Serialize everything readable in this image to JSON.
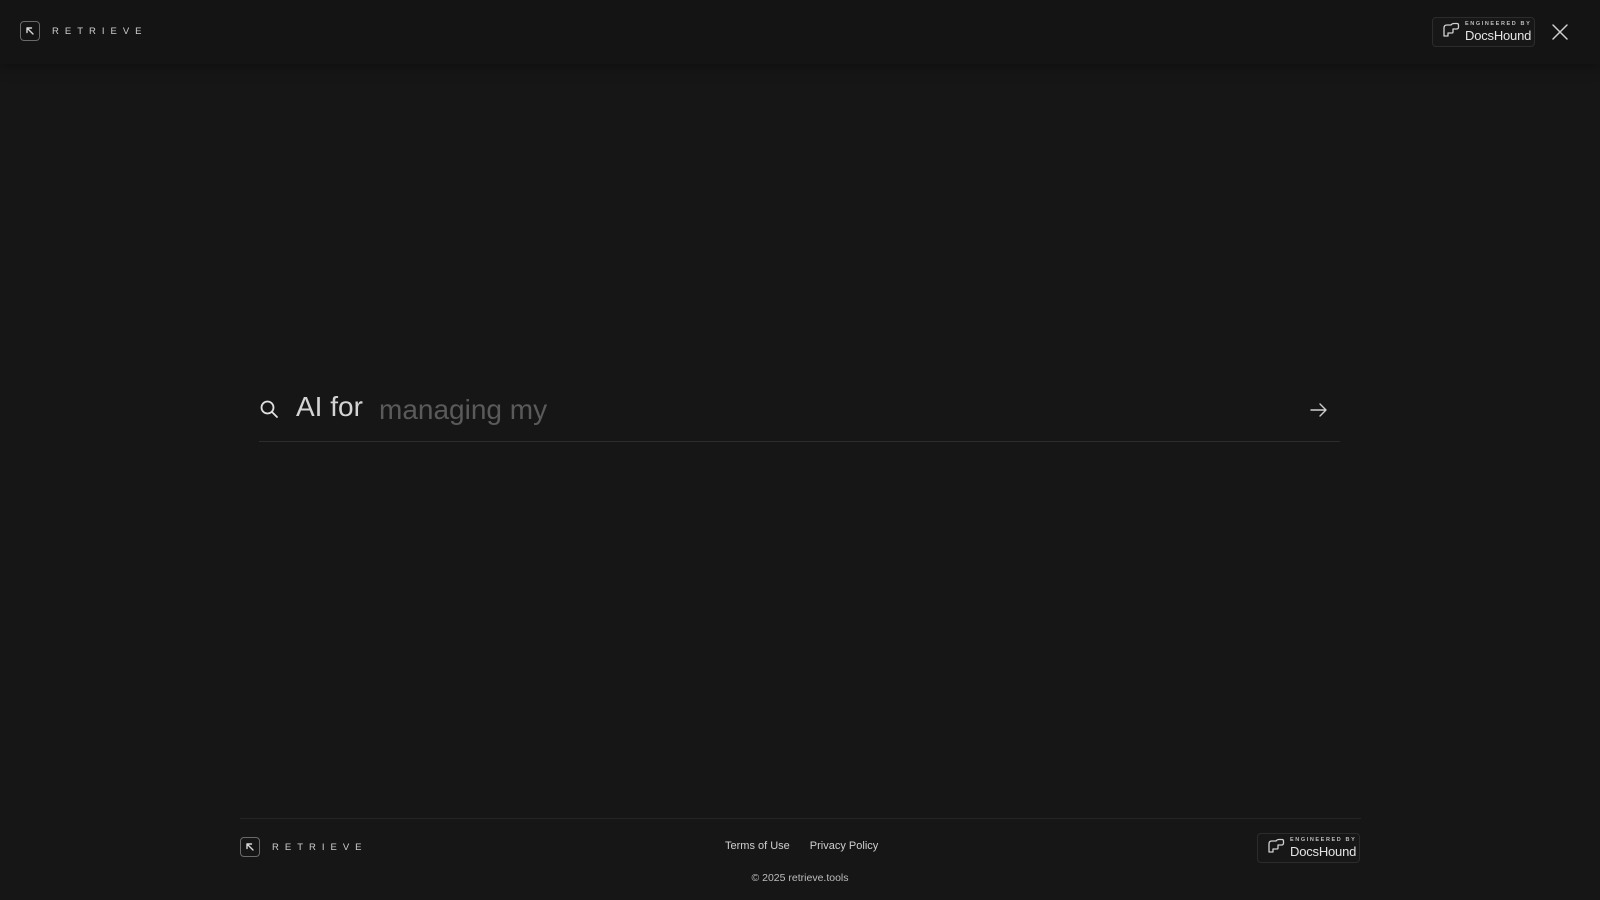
{
  "header": {
    "brand": "RETRIEVE",
    "badge": {
      "small": "ENGINEERED BY",
      "name": "DocsHound"
    }
  },
  "search": {
    "prefix": "AI for",
    "placeholder": "managing my"
  },
  "footer": {
    "brand": "RETRIEVE",
    "links": {
      "terms": "Terms of Use",
      "privacy": "Privacy Policy"
    },
    "badge": {
      "small": "ENGINEERED BY",
      "name": "DocsHound"
    },
    "copyright": "© 2025 retrieve.tools"
  },
  "colors": {
    "background": "#161616",
    "text": "#e6e6e6",
    "placeholder": "#5a5a5a",
    "divider": "#2c2c2c"
  },
  "icons": {
    "logo": "arrow-up-left-icon",
    "badge": "docshound-icon",
    "close": "close-icon",
    "search": "search-icon",
    "submit": "arrow-right-icon"
  }
}
